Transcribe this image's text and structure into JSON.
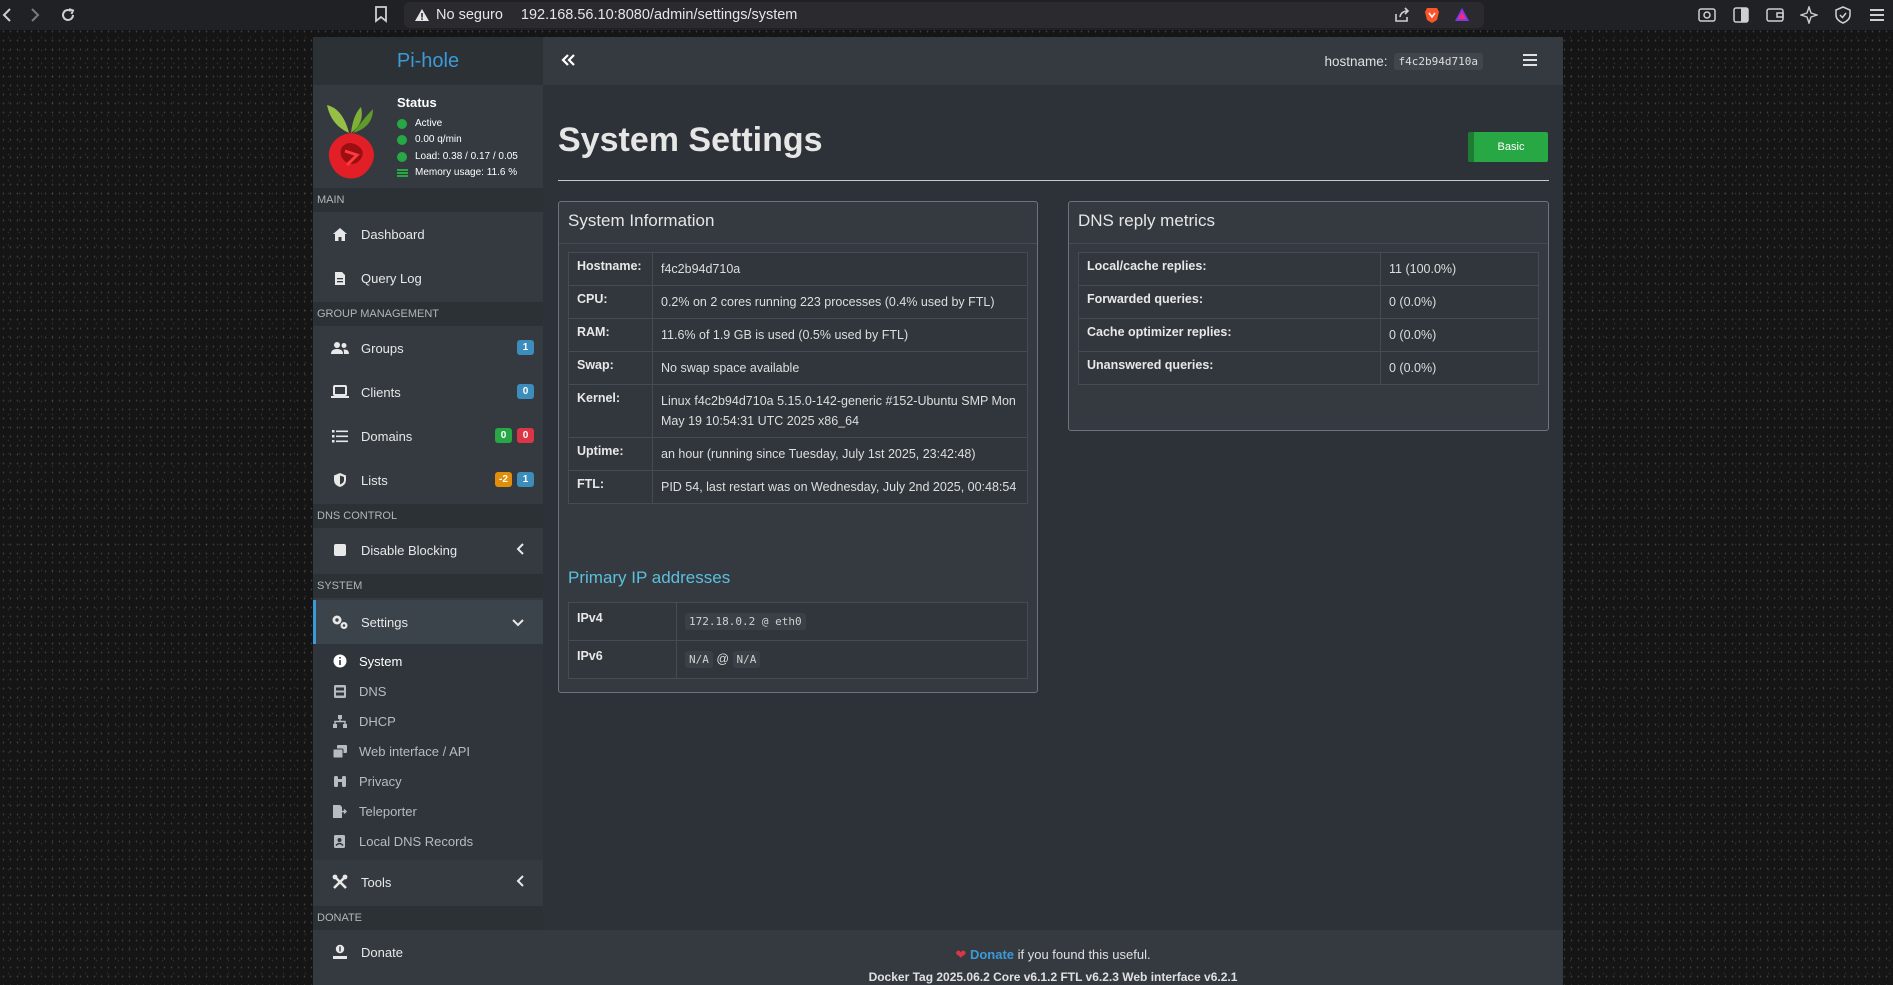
{
  "browser": {
    "insecure_label": "No seguro",
    "url": "192.168.56.10:8080/admin/settings/system"
  },
  "sidebar": {
    "logo_text": "Pi-hole",
    "status": {
      "title": "Status",
      "active": "Active",
      "rate": "0.00 q/min",
      "load": "Load: 0.38 / 0.17 / 0.05",
      "memory": "Memory usage: 11.6 %"
    },
    "sections": {
      "main": "MAIN",
      "group_management": "GROUP MANAGEMENT",
      "dns_control": "DNS CONTROL",
      "system": "SYSTEM",
      "donate": "DONATE"
    },
    "items": {
      "dashboard": "Dashboard",
      "query_log": "Query Log",
      "groups": "Groups",
      "groups_badge": "1",
      "clients": "Clients",
      "clients_badge": "0",
      "domains": "Domains",
      "domains_badge_allow": "0",
      "domains_badge_deny": "0",
      "lists": "Lists",
      "lists_badge_warn": "-2",
      "lists_badge_info": "1",
      "disable_blocking": "Disable Blocking",
      "settings": "Settings",
      "tools": "Tools",
      "donate": "Donate"
    },
    "settings_sub": {
      "system": "System",
      "dns": "DNS",
      "dhcp": "DHCP",
      "web": "Web interface / API",
      "privacy": "Privacy",
      "teleporter": "Teleporter",
      "local_dns": "Local DNS Records"
    }
  },
  "topbar": {
    "hostname_label": "hostname:",
    "hostname_value": "f4c2b94d710a"
  },
  "main": {
    "title": "System Settings",
    "mode_button": "Basic",
    "system_info": {
      "title": "System Information",
      "rows": [
        {
          "k": "Hostname:",
          "v": "f4c2b94d710a"
        },
        {
          "k": "CPU:",
          "v": "0.2% on 2 cores running 223 processes (0.4% used by FTL)"
        },
        {
          "k": "RAM:",
          "v": "11.6% of 1.9 GB is used (0.5% used by FTL)"
        },
        {
          "k": "Swap:",
          "v": "No swap space available"
        },
        {
          "k": "Kernel:",
          "v": "Linux f4c2b94d710a 5.15.0-142-generic #152-Ubuntu SMP Mon May 19 10:54:31 UTC 2025 x86_64"
        },
        {
          "k": "Uptime:",
          "v": "an hour (running since Tuesday, July 1st 2025, 23:42:48)"
        },
        {
          "k": "FTL:",
          "v": "PID 54, last restart was on Wednesday, July 2nd 2025, 00:48:54"
        }
      ],
      "ip_title": "Primary IP addresses",
      "ipv4_label": "IPv4",
      "ipv4_value": "172.18.0.2 @ eth0",
      "ipv6_label": "IPv6",
      "ipv6_addr": "N/A",
      "ipv6_at": "@",
      "ipv6_iface": "N/A"
    },
    "dns_metrics": {
      "title": "DNS reply metrics",
      "rows": [
        {
          "k": "Local/cache replies:",
          "v": "11 (100.0%)"
        },
        {
          "k": "Forwarded queries:",
          "v": "0 (0.0%)"
        },
        {
          "k": "Cache optimizer replies:",
          "v": "0 (0.0%)"
        },
        {
          "k": "Unanswered queries:",
          "v": "0 (0.0%)"
        }
      ]
    }
  },
  "footer": {
    "donate_link": "Donate",
    "donate_suffix": " if you found this useful.",
    "versions": "Docker Tag 2025.06.2 Core v6.1.2 FTL v6.2.3 Web interface v6.2.1"
  },
  "colors": {
    "accent": "#3c9ad8",
    "success": "#28a745",
    "danger": "#dc3545",
    "warning": "#e08e0b",
    "info": "#3c8dbc"
  }
}
